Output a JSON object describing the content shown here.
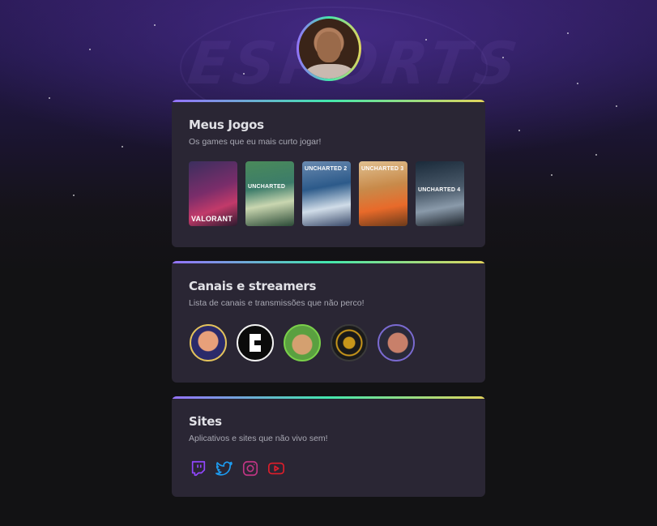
{
  "profile": {
    "avatar_alt": "Foto de perfil"
  },
  "background": {
    "watermark": "ESPORTS"
  },
  "cards": {
    "games": {
      "title": "Meus Jogos",
      "subtitle": "Os games que eu mais curto jogar!",
      "items": [
        {
          "caption": "VALORANT"
        },
        {
          "caption": "UNCHARTED"
        },
        {
          "caption": "UNCHARTED 2"
        },
        {
          "caption": "UNCHARTED 3"
        },
        {
          "caption": "UNCHARTED 4"
        }
      ]
    },
    "channels": {
      "title": "Canais e streamers",
      "subtitle": "Lista de canais e transmissões que não perco!"
    },
    "sites": {
      "title": "Sites",
      "subtitle": "Aplicativos e sites que não vivo sem!",
      "icons": [
        "twitch-icon",
        "twitter-icon",
        "instagram-icon",
        "youtube-icon"
      ]
    }
  },
  "colors": {
    "accent_gradient": [
      "#9572fc",
      "#43e7ad",
      "#e2d45c"
    ],
    "card_bg": "#2a2634",
    "twitch": "#9146ff",
    "twitter": "#1d9bf0",
    "instagram": "#c13584",
    "youtube": "#e01e2b"
  }
}
